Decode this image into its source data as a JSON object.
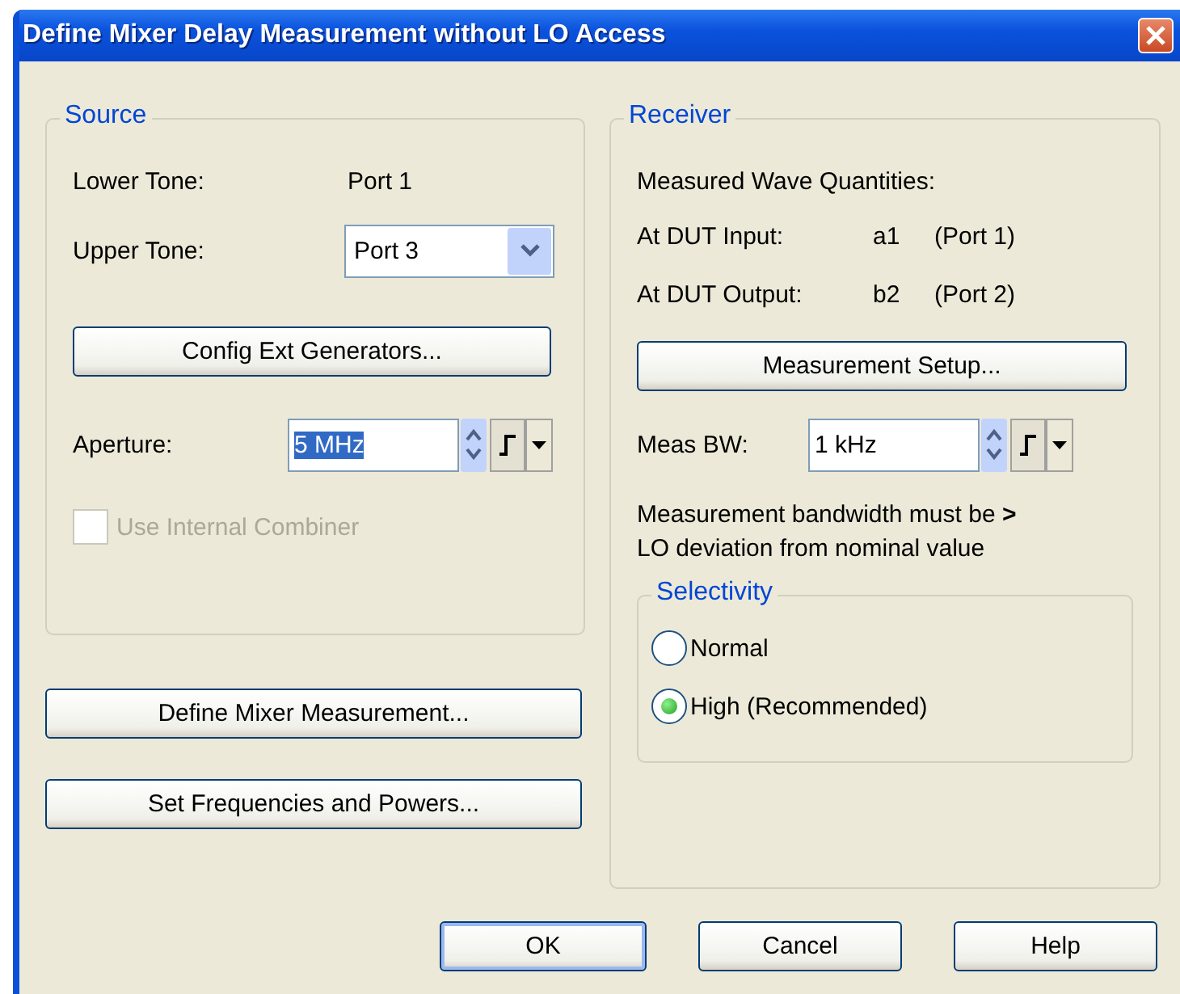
{
  "window": {
    "title": "Define Mixer Delay Measurement without LO Access"
  },
  "source": {
    "title": "Source",
    "lower_tone": {
      "label": "Lower Tone:",
      "value": "Port 1"
    },
    "upper_tone": {
      "label": "Upper Tone:",
      "value": "Port 3"
    },
    "config_button": "Config Ext Generators...",
    "aperture": {
      "label": "Aperture:",
      "value": "5 MHz",
      "highlighted": true
    },
    "combiner": {
      "label": "Use Internal Combiner",
      "checked": false,
      "disabled": true
    }
  },
  "left_buttons": [
    "Define Mixer Measurement...",
    "Set Frequencies and Powers..."
  ],
  "receiver": {
    "title": "Receiver",
    "heading": "Measured Wave Quantities:",
    "rows": [
      {
        "label": "At DUT Input:",
        "wave": "a1",
        "port": "(Port 1)"
      },
      {
        "label": "At DUT Output:",
        "wave": "b2",
        "port": "(Port 2)"
      }
    ],
    "setup_button": "Measurement Setup...",
    "meas_bw": {
      "label": "Meas BW:",
      "value": "1 kHz",
      "highlighted": false
    },
    "note": "Measurement bandwidth must be **>** LO deviation from nominal value",
    "selectivity": {
      "title": "Selectivity",
      "options": [
        {
          "label": "Normal",
          "selected": false
        },
        {
          "label": "High (Recommended)",
          "selected": true
        }
      ]
    }
  },
  "buttons": [
    {
      "label": "OK",
      "default": true
    },
    {
      "label": "Cancel",
      "default": false
    },
    {
      "label": "Help",
      "default": false
    }
  ]
}
